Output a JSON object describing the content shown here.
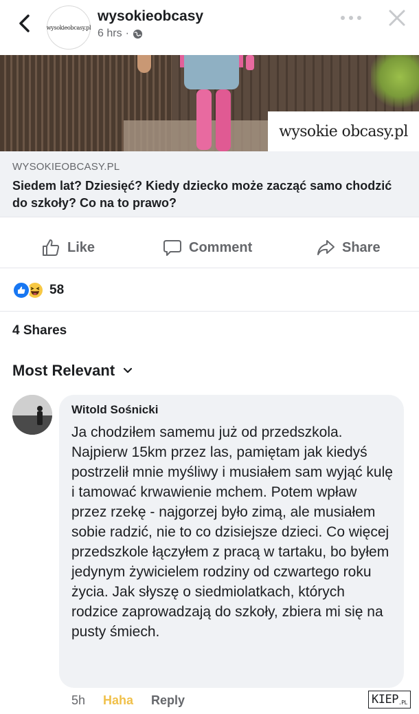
{
  "header": {
    "page_name": "wysokieobcasy",
    "logo_text": "wysokieobcasy.pl",
    "time": "6 hrs",
    "separator": "·"
  },
  "link_preview": {
    "watermark": "wysokie obcasy.pl",
    "domain": "WYSOKIEOBCASY.PL",
    "title": "Siedem lat? Dziesięć? Kiedy dziecko może zacząć samo chodzić do szkoły? Co na to prawo?"
  },
  "actions": {
    "like": "Like",
    "comment": "Comment",
    "share": "Share"
  },
  "reactions": {
    "count": "58"
  },
  "shares": "4 Shares",
  "sort": {
    "label": "Most Relevant"
  },
  "comment": {
    "author": "Witold Sośnicki",
    "text": "Ja chodziłem samemu już od przedszkola. Najpierw 15km przez las, pamiętam jak kiedyś postrzelił mnie myśliwy i musiałem sam wyjąć kulę i tamować krwawienie mchem. Potem wpław przez rzekę - najgorzej było zimą, ale musiałem sobie radzić, nie to co dzisiejsze dzieci. Co więcej przedszkole łączyłem z pracą w tartaku, bo byłem jedynym żywicielem rodziny od czwartego roku życia. Jak słyszę o siedmiolatkach, których rodzice zaprowadzają do szkoły, zbiera mi się na pusty śmiech.",
    "time": "5h",
    "reaction_label": "Haha",
    "reply_label": "Reply"
  },
  "site_badge": {
    "main": "KIEP",
    "suffix": ".PL"
  },
  "colors": {
    "accent": "#1877f2",
    "haha": "#f0c04a",
    "muted": "#65676b",
    "bubble": "#f0f2f5"
  }
}
